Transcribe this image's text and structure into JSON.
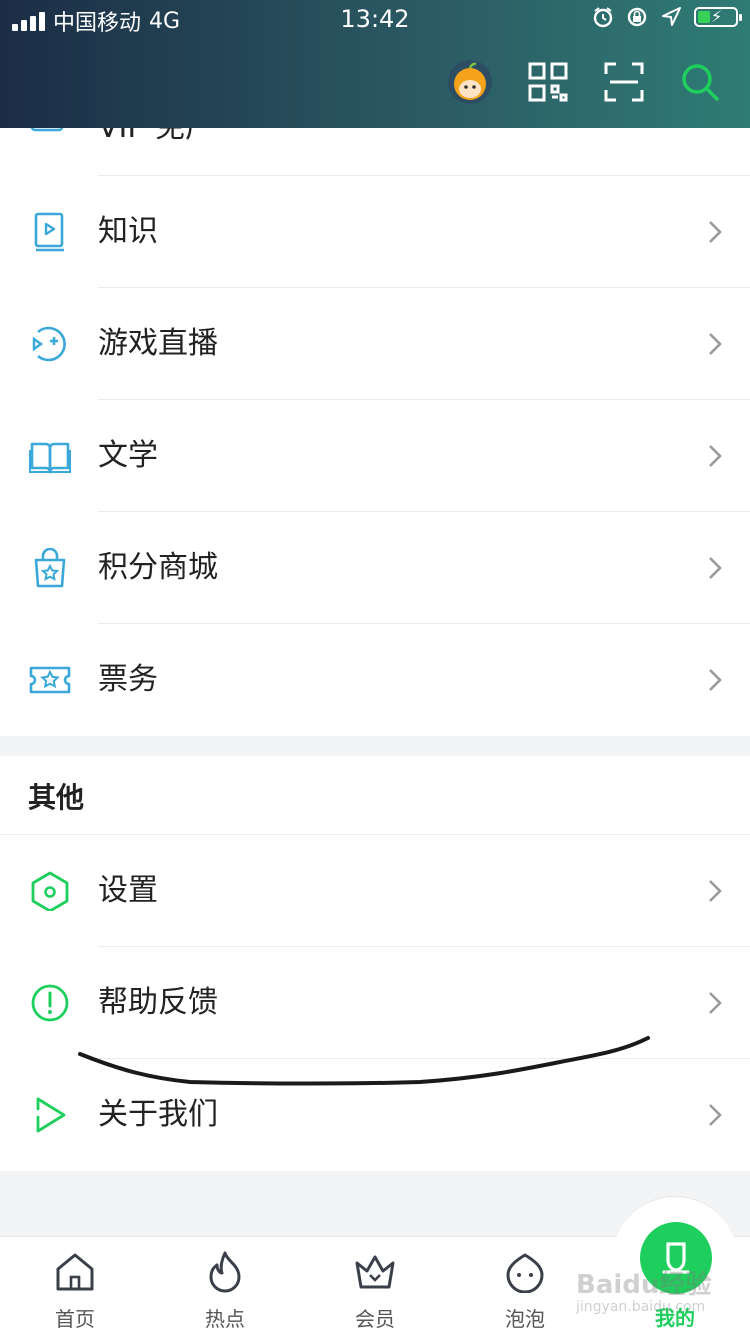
{
  "status_bar": {
    "carrier": "中国移动",
    "network": "4G",
    "time": "13:42"
  },
  "header": {
    "icons": [
      "avatar-icon",
      "qr-code-icon",
      "scan-icon",
      "search-icon"
    ],
    "accent": "#1fcf5e"
  },
  "partial_item": {
    "label": "VIP 免广",
    "icon": "vip-icon"
  },
  "menu": [
    {
      "label": "知识",
      "icon": "knowledge-icon"
    },
    {
      "label": "游戏直播",
      "icon": "game-live-icon"
    },
    {
      "label": "文学",
      "icon": "book-icon"
    },
    {
      "label": "积分商城",
      "icon": "points-mall-icon"
    },
    {
      "label": "票务",
      "icon": "ticket-icon"
    }
  ],
  "other_section": {
    "title": "其他",
    "items": [
      {
        "label": "设置",
        "icon": "settings-icon"
      },
      {
        "label": "帮助反馈",
        "icon": "help-icon"
      },
      {
        "label": "关于我们",
        "icon": "about-icon"
      }
    ]
  },
  "tabbar": {
    "tabs": [
      {
        "label": "首页",
        "icon": "home-icon"
      },
      {
        "label": "热点",
        "icon": "flame-icon"
      },
      {
        "label": "会员",
        "icon": "crown-icon"
      },
      {
        "label": "泡泡",
        "icon": "bubble-icon"
      },
      {
        "label": "我的",
        "icon": "mine-icon",
        "active": true
      }
    ]
  },
  "watermark": {
    "text": "Baidu经验",
    "sub": "jingyan.baidu.com"
  },
  "colors": {
    "blue_icon": "#3aa8d8",
    "green_icon": "#1fcf5e",
    "chevron": "#9a9a9a"
  }
}
